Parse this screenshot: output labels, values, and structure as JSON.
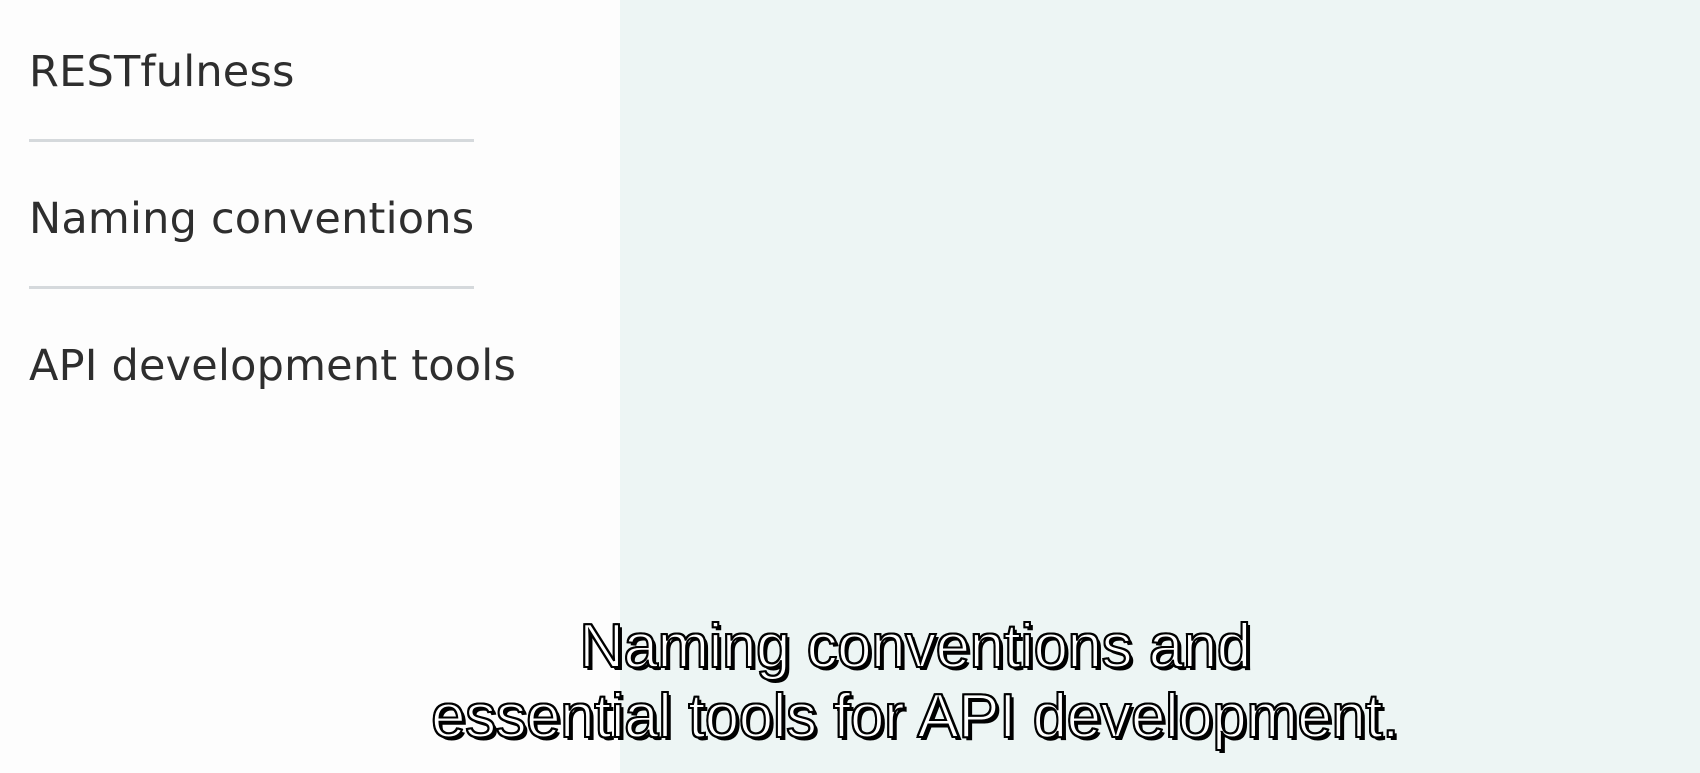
{
  "topics": {
    "items": [
      {
        "label": "RESTfulness"
      },
      {
        "label": "Naming conventions"
      },
      {
        "label": "API development tools"
      }
    ]
  },
  "subtitle": {
    "line1": "Naming conventions and",
    "line2": "essential tools for API development."
  },
  "colors": {
    "left_panel": "#fdfdfd",
    "right_panel": "#edf5f4",
    "topic_text": "#2e2e2e",
    "divider": "#d5d9dc",
    "caption_fill": "#ffffff",
    "caption_outline": "#000000"
  }
}
